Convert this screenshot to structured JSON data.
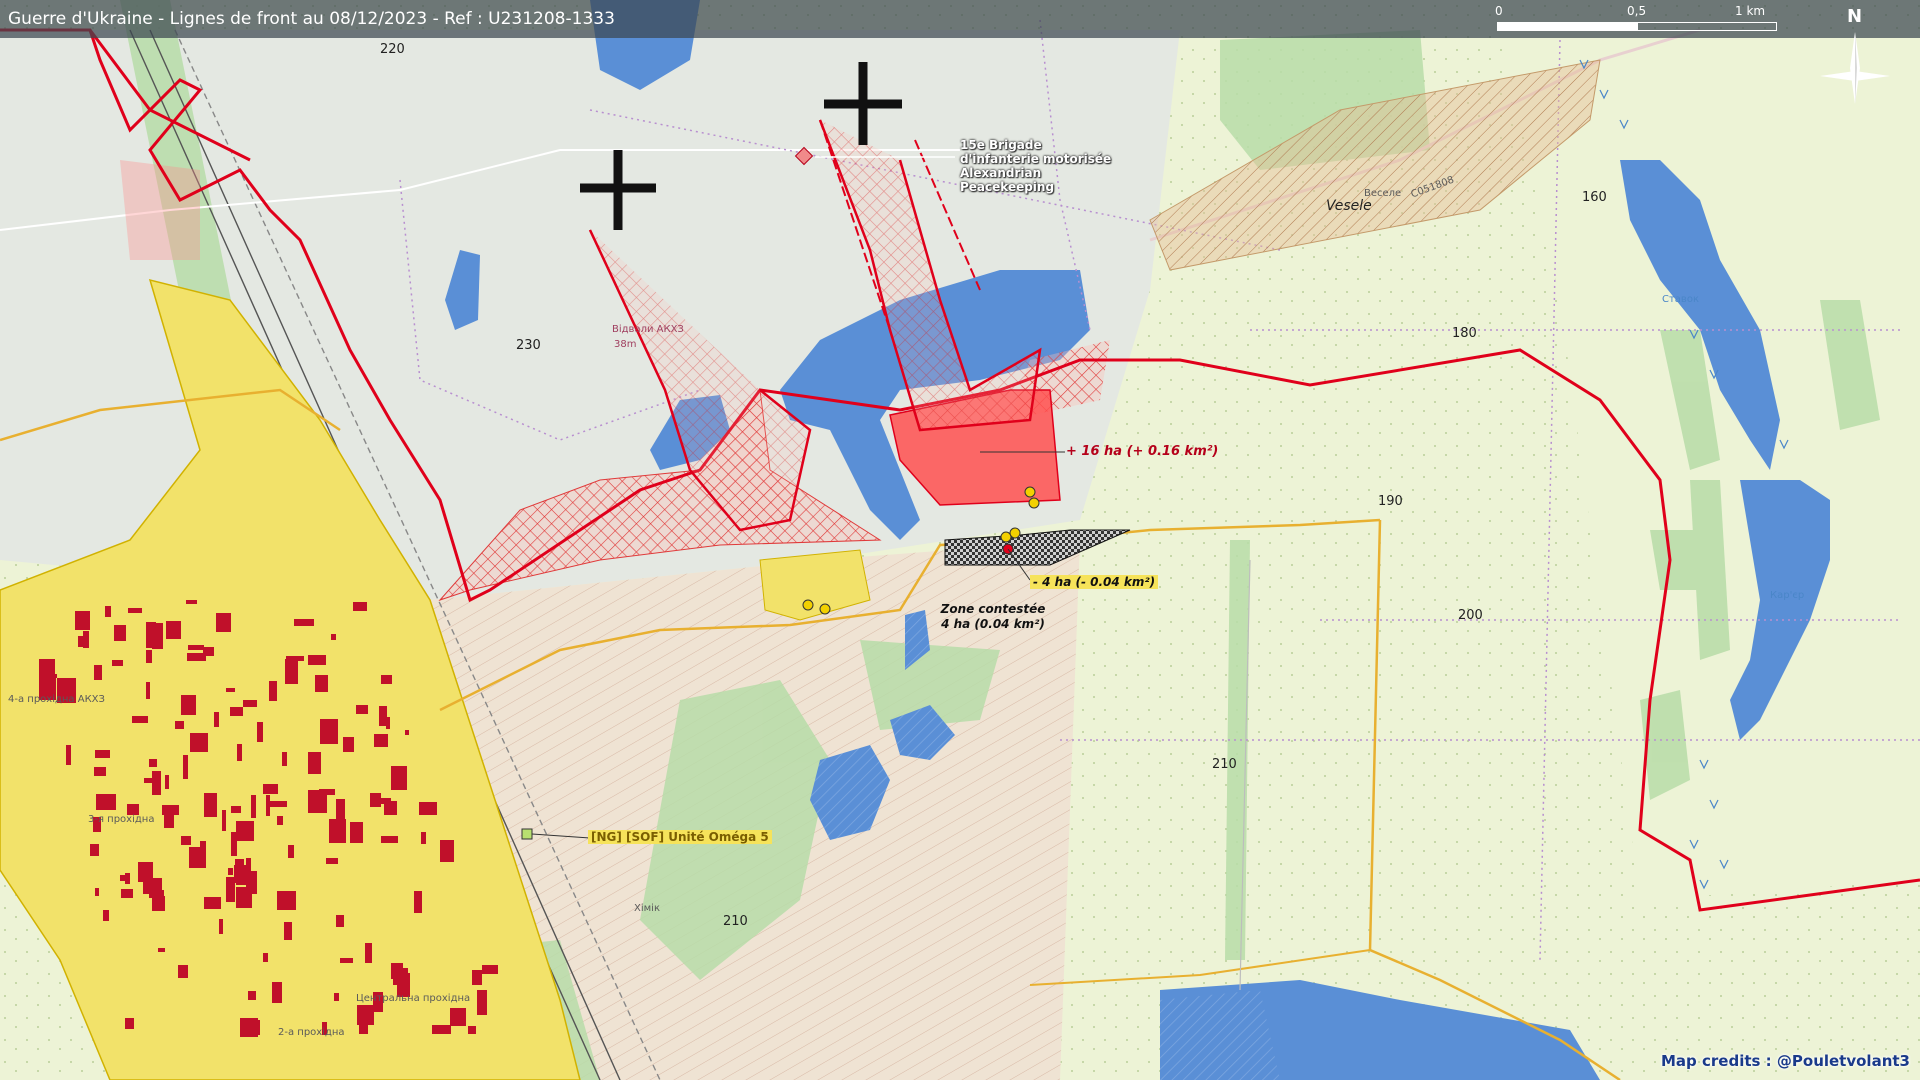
{
  "header": {
    "title": "Guerre d'Ukraine - Lignes de front au 08/12/2023 - Ref : U231208-1333"
  },
  "scale_bar": {
    "labels": [
      "0",
      "0,5",
      "1 km"
    ]
  },
  "north_arrow": {
    "label": "N"
  },
  "credits": "Map credits : @Pouletvolant3",
  "map_labels": {
    "elev_220": "220",
    "elev_230": "230",
    "elev_160": "160",
    "elev_180": "180",
    "elev_190": "190",
    "elev_200": "200",
    "elev_210_right": "210",
    "elev_210_bottom": "210",
    "vesele_latin": "Vesele",
    "vesele_cyr": "Веселе",
    "road_c051808": "C051808",
    "dump_name": "Відвали АКХЗ",
    "dump_height": "38m",
    "stavok": "Ставок",
    "karyer": "Кар'єр",
    "khimik": "Хімік",
    "pass_4": "4-а прохідна АКХЗ",
    "pass_3": "3-я прохідна",
    "pass_2": "2-а прохідна",
    "pass_central": "Центральна прохідна"
  },
  "annotations": {
    "unit_15": "15e Brigade d'infanterie motorisée Alexandrian Peacekeeping",
    "gain": "+ 16 ha (+ 0.16 km²)",
    "loss": "- 4 ha (- 0.04 km²)",
    "contested_title": "Zone contestée",
    "contested_area": "4 ha (0.04 km²)",
    "sof": "[NG] [SOF] Unité Oméga 5"
  },
  "colors": {
    "front_red": "#e0001b",
    "russian_fill": "#ff5050",
    "urban_yellow": "#f2e26a",
    "water": "#5a8fd6",
    "forest": "#a8d79a",
    "field": "#eef4d8",
    "road_orange": "#e8b030"
  }
}
